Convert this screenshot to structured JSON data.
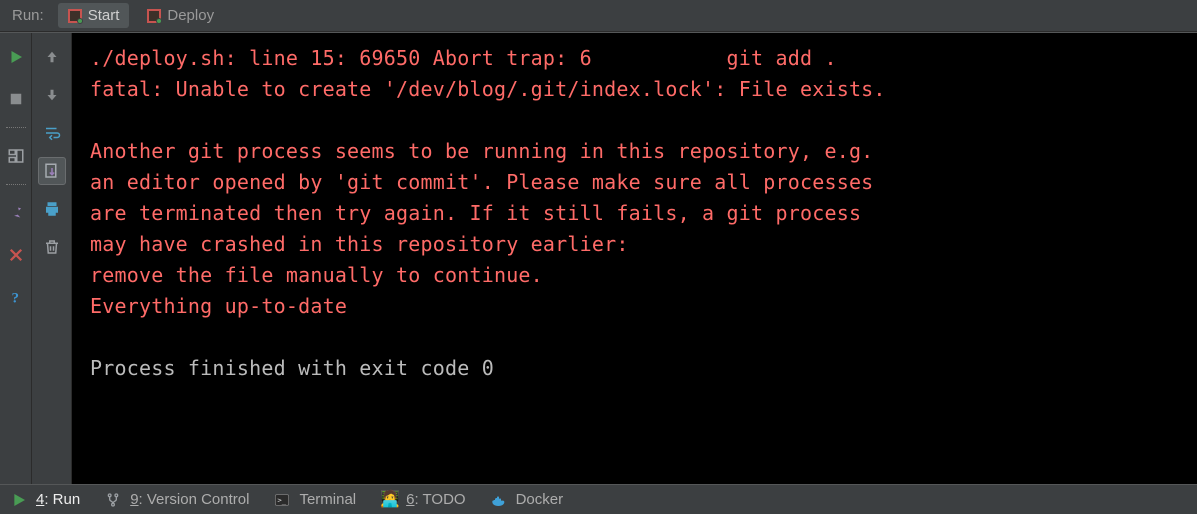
{
  "tabbar": {
    "panel_label": "Run:",
    "tabs": [
      {
        "label": "Start",
        "active": true
      },
      {
        "label": "Deploy",
        "active": false
      }
    ]
  },
  "gutter_left": {
    "run": "run-icon",
    "stop": "stop-icon",
    "layout": "layout-icon",
    "pin": "pin-icon",
    "close": "close-icon",
    "help": "help-icon"
  },
  "gutter_right": {
    "up": "arrow-up-icon",
    "down": "arrow-down-icon",
    "wrap": "soft-wrap-icon",
    "scroll": "scroll-to-end-icon",
    "print": "print-icon",
    "clear": "clear-all-icon"
  },
  "console": {
    "lines": [
      {
        "cls": "err",
        "text": "./deploy.sh: line 15: 69650 Abort trap: 6           git add ."
      },
      {
        "cls": "err",
        "text": "fatal: Unable to create '/dev/blog/.git/index.lock': File exists."
      },
      {
        "cls": "err",
        "text": ""
      },
      {
        "cls": "err",
        "text": "Another git process seems to be running in this repository, e.g."
      },
      {
        "cls": "err",
        "text": "an editor opened by 'git commit'. Please make sure all processes"
      },
      {
        "cls": "err",
        "text": "are terminated then try again. If it still fails, a git process"
      },
      {
        "cls": "err",
        "text": "may have crashed in this repository earlier:"
      },
      {
        "cls": "err",
        "text": "remove the file manually to continue."
      },
      {
        "cls": "err",
        "text": "Everything up-to-date"
      },
      {
        "cls": "info",
        "text": ""
      },
      {
        "cls": "info",
        "text": "Process finished with exit code 0"
      }
    ]
  },
  "tool_windows": {
    "run": {
      "mnemonic": "4",
      "label": ": Run"
    },
    "vcs": {
      "mnemonic": "9",
      "label": ": Version Control"
    },
    "terminal": {
      "label": "Terminal"
    },
    "todo": {
      "mnemonic": "6",
      "label": ": TODO"
    },
    "docker": {
      "label": "Docker"
    }
  }
}
